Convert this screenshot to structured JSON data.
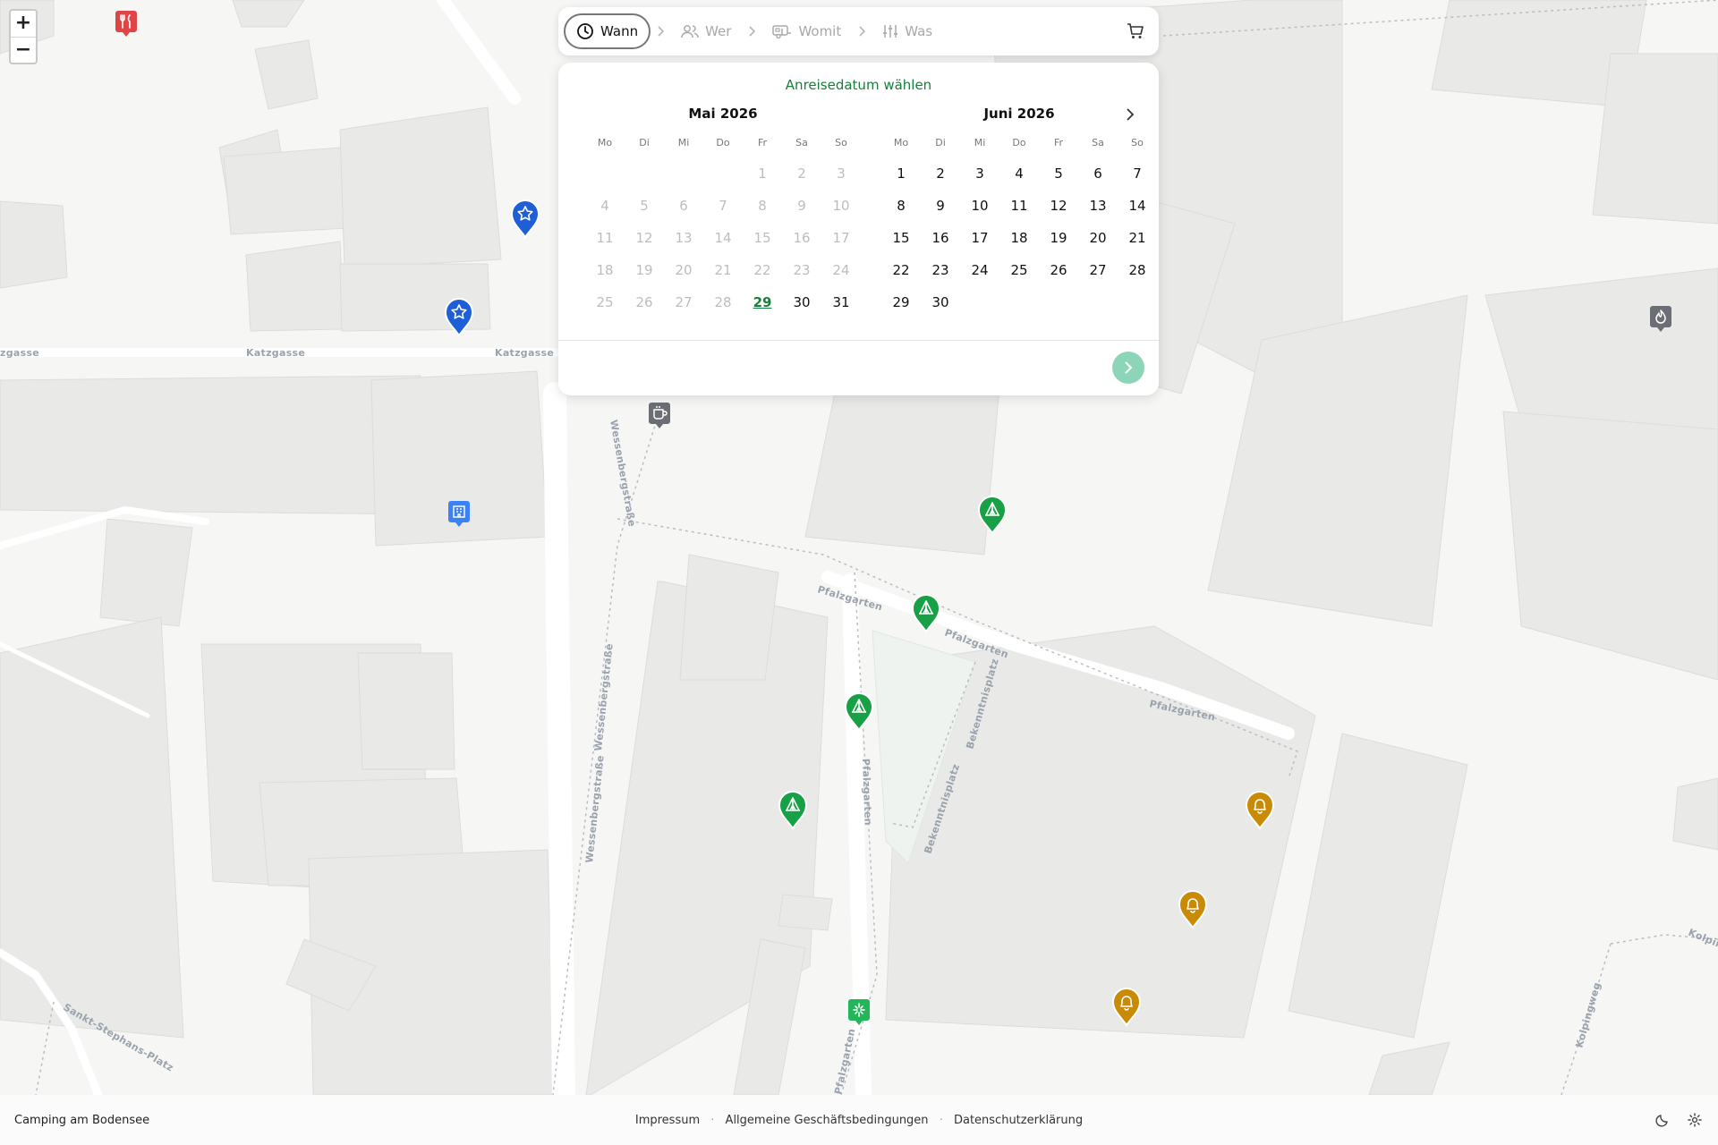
{
  "zoom": {
    "in_label": "+",
    "out_label": "−"
  },
  "streets": {
    "katzgasse_a": "zgasse",
    "katzgasse_b": "Katzgasse",
    "katzgasse_c": "Katzgasse",
    "wessenberg_a": "Wessenbergstraße",
    "wessenberg_b": "Wessenbergstraße",
    "wessenberg_c": "Wessenbergstraße",
    "pfalzgarten_a": "Pfalzgarten",
    "pfalzgarten_b": "Pfalzgarten",
    "pfalzgarten_c": "Pfalzgarten",
    "pfalzgarten_d": "Pfalzgarten",
    "pfalzgarten_e": "Pfalzgarten",
    "bekenntnis_a": "Bekenntnisplatz",
    "bekenntnis_b": "Bekenntnisplatz",
    "stephans": "Sankt-Stephans-Platz",
    "kolpingweg": "Kolpingweg",
    "kolping_edge": "Kolpin"
  },
  "stepper": {
    "steps": [
      {
        "label": "Wann",
        "icon": "clock-icon",
        "active": true
      },
      {
        "label": "Wer",
        "icon": "users-icon",
        "active": false
      },
      {
        "label": "Womit",
        "icon": "caravan-icon",
        "active": false
      },
      {
        "label": "Was",
        "icon": "sliders-icon",
        "active": false
      }
    ],
    "cart_icon": "cart-icon"
  },
  "calendar": {
    "title": "Anreisedatum wählen",
    "weekdays": [
      "Mo",
      "Di",
      "Mi",
      "Do",
      "Fr",
      "Sa",
      "So"
    ],
    "months": [
      {
        "name": "Mai 2026",
        "offset": 4,
        "days": 31,
        "disabled_through": 28,
        "today": 29
      },
      {
        "name": "Juni 2026",
        "offset": 0,
        "days": 30,
        "disabled_through": 0,
        "today": null
      }
    ]
  },
  "colors": {
    "accent_green": "#16803c",
    "next_button": "#8dd5b8",
    "marker_blue": "#1e5ed6",
    "marker_green": "#17a045",
    "marker_amber": "#c98a06",
    "marker_gray": "#6b6f75",
    "marker_red": "#e04545"
  },
  "map_markers": [
    {
      "type": "favorite-star",
      "icon": "star-icon",
      "color": "blue"
    },
    {
      "type": "favorite-star",
      "icon": "star-icon",
      "color": "blue"
    },
    {
      "type": "tent-pitch",
      "icon": "tent-icon",
      "color": "green"
    },
    {
      "type": "tent-pitch",
      "icon": "tent-icon",
      "color": "green"
    },
    {
      "type": "tent-pitch",
      "icon": "tent-icon",
      "color": "green"
    },
    {
      "type": "tent-pitch",
      "icon": "tent-icon",
      "color": "green"
    },
    {
      "type": "bell-pitch",
      "icon": "bell-icon",
      "color": "amber"
    },
    {
      "type": "bell-pitch",
      "icon": "bell-icon",
      "color": "amber"
    },
    {
      "type": "bell-pitch",
      "icon": "bell-icon",
      "color": "amber"
    },
    {
      "type": "restaurant",
      "icon": "fork-knife-icon",
      "color": "red"
    },
    {
      "type": "cafe",
      "icon": "coffee-icon",
      "color": "gray"
    },
    {
      "type": "building",
      "icon": "building-icon",
      "color": "blue"
    },
    {
      "type": "playground",
      "icon": "sparkle-icon",
      "color": "green"
    },
    {
      "type": "fire",
      "icon": "flame-icon",
      "color": "gray"
    }
  ],
  "footer": {
    "brand": "Camping am Bodensee",
    "links": [
      "Impressum",
      "Allgemeine Geschäftsbedingungen",
      "Datenschutzerklärung"
    ],
    "separator": "·",
    "icons": [
      "moon-icon",
      "gear-icon"
    ]
  }
}
